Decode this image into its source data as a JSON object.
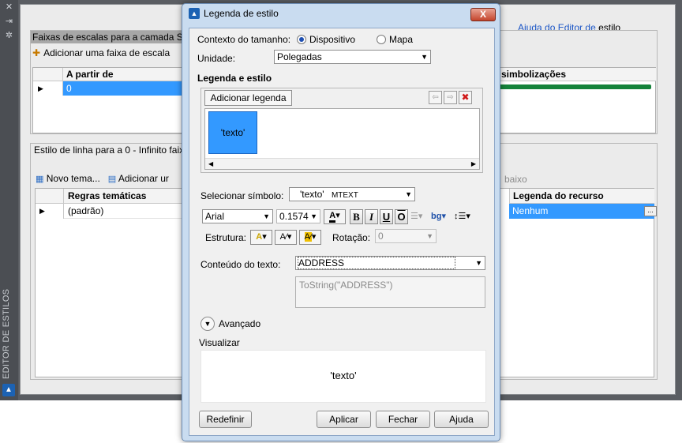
{
  "palette": {
    "vertical_title": "EDITOR DE ESTILOS",
    "help_prefix": "",
    "help_link": "Ajuda do Editor de",
    "help_suffix": " estilo",
    "section1": {
      "header": "Faixas de escalas para a camada Sch",
      "add_button": "Adicionar uma faixa de escala",
      "col_from": "A partir de",
      "row_value": "0",
      "right_col": "r: simbolizações"
    },
    "section2": {
      "title": "Estilo de linha para a 0 - Infinito faix",
      "new_theme": "Novo tema...",
      "add_rule": "Adicionar ur",
      "low_text": "baixo",
      "col_rules": "Regras temáticas",
      "row_rule": "(padrão)",
      "col_feature_label": "Legenda do recurso",
      "row_feature_label": "Nenhum",
      "dots": "..."
    }
  },
  "dialog": {
    "title": "Legenda de estilo",
    "close": "X",
    "size_context_label": "Contexto do tamanho:",
    "radio_device": "Dispositivo",
    "radio_map": "Mapa",
    "unit_label": "Unidade:",
    "unit_value": "Polegadas",
    "label_style_heading": "Legenda e estilo",
    "add_label_button": "Adicionar legenda",
    "label_item": "'texto'",
    "select_symbol_label": "Selecionar símbolo:",
    "symbol_name": "'texto'",
    "symbol_type": "MTEXT",
    "font_value": "Arial",
    "size_value": "0.1574",
    "bold": "B",
    "italic": "I",
    "underline": "U",
    "overline": "O",
    "bg_label": "bg",
    "structure_label": "Estrutura:",
    "rotation_label": "Rotação:",
    "rotation_value": "0",
    "text_content_label": "Conteúdo do texto:",
    "text_content_value": "ADDRESS",
    "expression": "ToString(\"ADDRESS\")",
    "advanced_label": "Avançado",
    "preview_label": "Visualizar",
    "preview_text": "'texto'",
    "buttons": {
      "reset": "Redefinir",
      "apply": "Aplicar",
      "close": "Fechar",
      "help": "Ajuda"
    }
  }
}
